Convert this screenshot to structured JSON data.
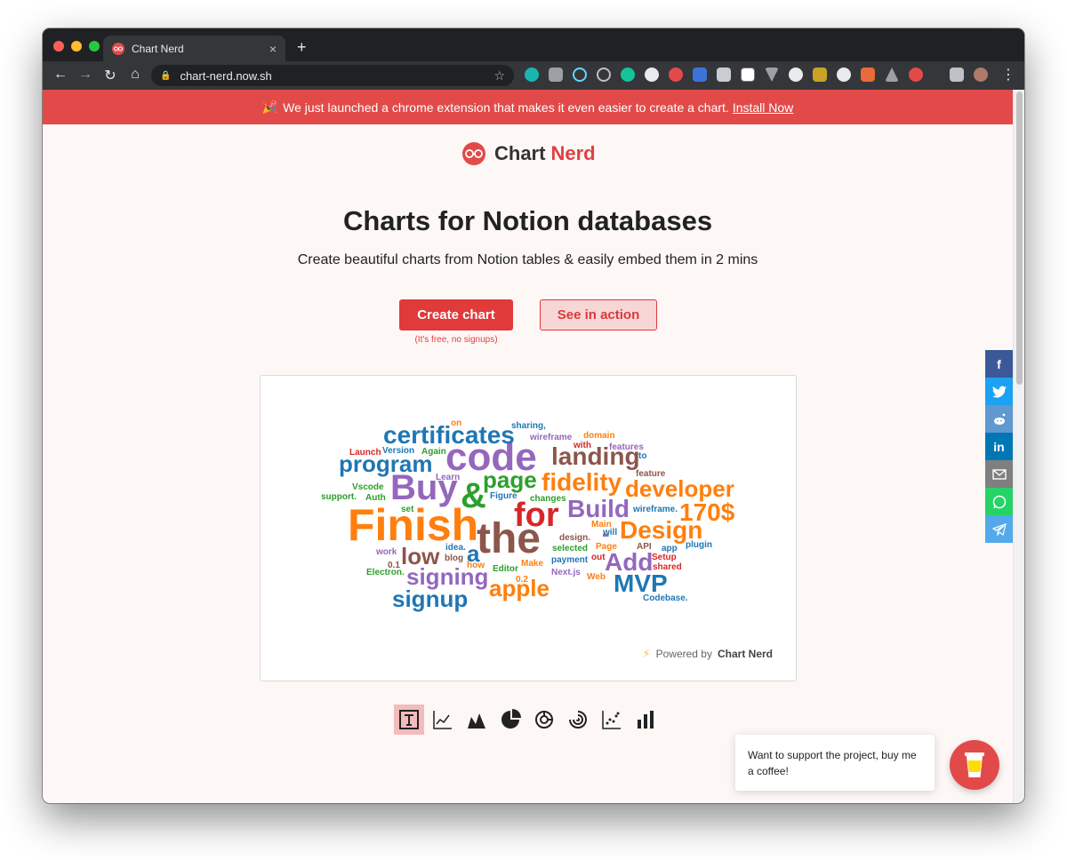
{
  "browser": {
    "tab_title": "Chart Nerd",
    "url": "chart-nerd.now.sh",
    "new_tab_label": "+",
    "close_label": "×"
  },
  "banner": {
    "emoji": "🎉",
    "text": "We just launched a chrome extension that makes it even easier to create a chart.",
    "link": "Install Now"
  },
  "logo": {
    "text1": "Chart",
    "text2": "Nerd"
  },
  "hero": {
    "title": "Charts for Notion databases",
    "subtitle": "Create beautiful charts from Notion tables & easily embed them in 2 mins",
    "create_button": "Create chart",
    "see_button": "See in action",
    "free_note": "(It's free, no signups)"
  },
  "powered_by": {
    "prefix": "Powered by",
    "brand": "Chart Nerd"
  },
  "chart_data": {
    "type": "wordcloud",
    "words": [
      {
        "text": "Finish",
        "color": "#ff7f0e",
        "size": 50
      },
      {
        "text": "the",
        "color": "#8c564b",
        "size": 48
      },
      {
        "text": "code",
        "color": "#9467bd",
        "size": 44
      },
      {
        "text": "Buy",
        "color": "#9467bd",
        "size": 40
      },
      {
        "text": "&",
        "color": "#2ca02c",
        "size": 40
      },
      {
        "text": "for",
        "color": "#d62728",
        "size": 38
      },
      {
        "text": "certificates",
        "color": "#1f77b4",
        "size": 28
      },
      {
        "text": "program",
        "color": "#1f77b4",
        "size": 26
      },
      {
        "text": "landing",
        "color": "#8c564b",
        "size": 28
      },
      {
        "text": "page",
        "color": "#2ca02c",
        "size": 26
      },
      {
        "text": "fidelity",
        "color": "#ff7f0e",
        "size": 28
      },
      {
        "text": "developer",
        "color": "#ff7f0e",
        "size": 26
      },
      {
        "text": "Build",
        "color": "#9467bd",
        "size": 28
      },
      {
        "text": "170$",
        "color": "#ff7f0e",
        "size": 28
      },
      {
        "text": "Design",
        "color": "#ff7f0e",
        "size": 28
      },
      {
        "text": "a",
        "color": "#1f77b4",
        "size": 26
      },
      {
        "text": "low",
        "color": "#8c564b",
        "size": 26
      },
      {
        "text": "-",
        "color": "#9467bd",
        "size": 26
      },
      {
        "text": "Add",
        "color": "#9467bd",
        "size": 28
      },
      {
        "text": "MVP",
        "color": "#1f77b4",
        "size": 28
      },
      {
        "text": "signing",
        "color": "#9467bd",
        "size": 26
      },
      {
        "text": "signup",
        "color": "#1f77b4",
        "size": 26
      },
      {
        "text": "apple",
        "color": "#ff7f0e",
        "size": 26
      },
      {
        "text": "sharing,",
        "color": "#1f77b4",
        "size": 10
      },
      {
        "text": "on",
        "color": "#ff7f0e",
        "size": 10
      },
      {
        "text": "wireframe",
        "color": "#9467bd",
        "size": 10
      },
      {
        "text": "domain",
        "color": "#ff7f0e",
        "size": 10
      },
      {
        "text": "with",
        "color": "#d62728",
        "size": 10
      },
      {
        "text": "features",
        "color": "#9467bd",
        "size": 10
      },
      {
        "text": "to",
        "color": "#1f77b4",
        "size": 10
      },
      {
        "text": "Launch",
        "color": "#d62728",
        "size": 10
      },
      {
        "text": "Version",
        "color": "#1f77b4",
        "size": 10
      },
      {
        "text": "Again",
        "color": "#2ca02c",
        "size": 10
      },
      {
        "text": "Learn",
        "color": "#9467bd",
        "size": 10
      },
      {
        "text": "feature",
        "color": "#8c564b",
        "size": 10
      },
      {
        "text": "Vscode",
        "color": "#2ca02c",
        "size": 10
      },
      {
        "text": "support.",
        "color": "#2ca02c",
        "size": 10
      },
      {
        "text": "Auth",
        "color": "#2ca02c",
        "size": 10
      },
      {
        "text": "Figure",
        "color": "#1f77b4",
        "size": 10
      },
      {
        "text": "changes",
        "color": "#2ca02c",
        "size": 10
      },
      {
        "text": "set",
        "color": "#2ca02c",
        "size": 10
      },
      {
        "text": "wireframe.",
        "color": "#1f77b4",
        "size": 10
      },
      {
        "text": "Main",
        "color": "#ff7f0e",
        "size": 10
      },
      {
        "text": "will",
        "color": "#1f77b4",
        "size": 10
      },
      {
        "text": "design.",
        "color": "#8c564b",
        "size": 10
      },
      {
        "text": "idea.",
        "color": "#1f77b4",
        "size": 10
      },
      {
        "text": "selected",
        "color": "#2ca02c",
        "size": 10
      },
      {
        "text": "Page",
        "color": "#ff7f0e",
        "size": 10
      },
      {
        "text": "API",
        "color": "#8c564b",
        "size": 10
      },
      {
        "text": "app",
        "color": "#1f77b4",
        "size": 10
      },
      {
        "text": "plugin",
        "color": "#1f77b4",
        "size": 10
      },
      {
        "text": "work",
        "color": "#9467bd",
        "size": 10
      },
      {
        "text": "blog",
        "color": "#8c564b",
        "size": 10
      },
      {
        "text": "payment",
        "color": "#1f77b4",
        "size": 10
      },
      {
        "text": "out",
        "color": "#d62728",
        "size": 10
      },
      {
        "text": "Setup",
        "color": "#d62728",
        "size": 10
      },
      {
        "text": "0.1",
        "color": "#8c564b",
        "size": 10
      },
      {
        "text": "how",
        "color": "#ff7f0e",
        "size": 10
      },
      {
        "text": "Make",
        "color": "#ff7f0e",
        "size": 10
      },
      {
        "text": "shared",
        "color": "#d62728",
        "size": 10
      },
      {
        "text": "Electron.",
        "color": "#2ca02c",
        "size": 10
      },
      {
        "text": "Editor",
        "color": "#2ca02c",
        "size": 10
      },
      {
        "text": "Next.js",
        "color": "#9467bd",
        "size": 10
      },
      {
        "text": "0.2",
        "color": "#ff7f0e",
        "size": 10
      },
      {
        "text": "Web",
        "color": "#ff7f0e",
        "size": 10
      },
      {
        "text": "Codebase.",
        "color": "#1f77b4",
        "size": 10
      }
    ]
  },
  "coffee": {
    "text": "Want to support the project, buy me a coffee!"
  }
}
